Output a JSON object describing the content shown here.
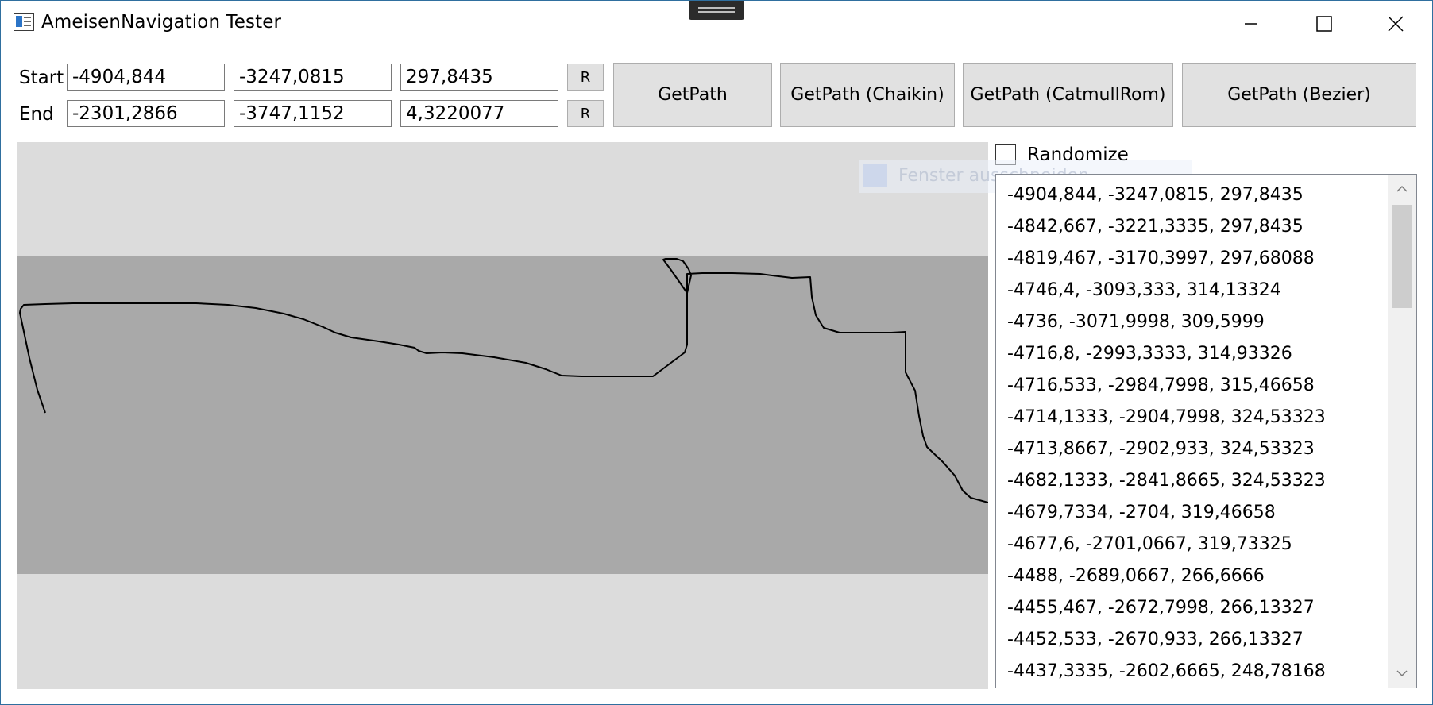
{
  "window": {
    "title": "AmeisenNavigation Tester"
  },
  "start": {
    "label": "Start",
    "x": "-4904,844",
    "y": "-3247,0815",
    "z": "297,8435",
    "random_label": "R"
  },
  "end": {
    "label": "End",
    "x": "-2301,2866",
    "y": "-3747,1152",
    "z": "4,3220077",
    "random_label": "R"
  },
  "buttons": {
    "get_path": "GetPath",
    "get_path_chaikin": "GetPath (Chaikin)",
    "get_path_catmullrom": "GetPath (CatmullRom)",
    "get_path_bezier": "GetPath (Bezier)"
  },
  "randomize": {
    "label": "Randomize",
    "checked": false
  },
  "overlay_ghost_text": "Fenster ausschneiden",
  "path_points": [
    "-4904,844, -3247,0815, 297,8435",
    "-4842,667, -3221,3335, 297,8435",
    "-4819,467, -3170,3997, 297,68088",
    "-4746,4, -3093,333, 314,13324",
    "-4736, -3071,9998, 309,5999",
    "-4716,8, -2993,3333, 314,93326",
    "-4716,533, -2984,7998, 315,46658",
    "-4714,1333, -2904,7998, 324,53323",
    "-4713,8667, -2902,933, 324,53323",
    "-4682,1333, -2841,8665, 324,53323",
    "-4679,7334, -2704, 319,46658",
    "-4677,6, -2701,0667, 319,73325",
    "-4488, -2689,0667, 266,6666",
    "-4455,467, -2672,7998, 266,13327",
    "-4452,533, -2670,933, 266,13327",
    "-4437,3335, -2602,6665, 248,78168"
  ],
  "colors": {
    "canvas_background": "#dcdcdc",
    "map_band": "#a9a9a9",
    "path_line": "#000000",
    "button_face": "#e1e1e1"
  }
}
